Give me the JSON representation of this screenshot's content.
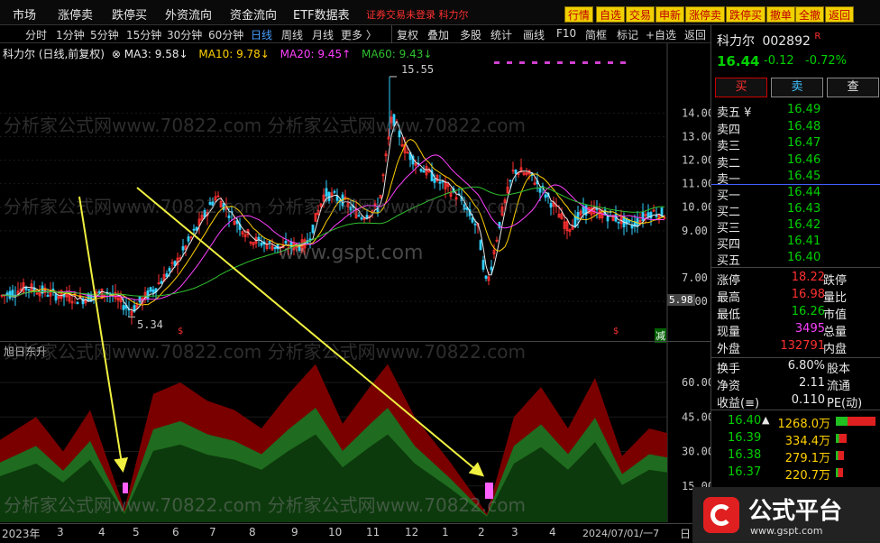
{
  "menu": {
    "items": [
      "市场",
      "涨停卖",
      "跌停买",
      "外资流向",
      "资金流向",
      "ETF数据表"
    ],
    "ticker_text": "证券交易未登录   科力尔",
    "buttons": [
      "行情",
      "自选",
      "交易",
      "申新",
      "涨停卖",
      "跌停买",
      "撤单",
      "全撤",
      "返回"
    ]
  },
  "toolbar": {
    "periods": [
      "分时",
      "1分钟",
      "5分钟",
      "15分钟",
      "30分钟",
      "60分钟",
      "日线",
      "周线",
      "月线",
      "更多 〉"
    ],
    "active_period": "日线",
    "tools": [
      "复权",
      "叠加",
      "多股",
      "统计",
      "画线",
      "F10",
      "简框",
      "标记",
      "+自选",
      "返回"
    ]
  },
  "chart_header": {
    "title": "科力尔 (日线,前复权)",
    "ma3": "MA3: 9.58↓",
    "ma10": "MA10: 9.78↓",
    "ma20": "MA20: 9.45↑",
    "ma60": "MA60: 9.43↓"
  },
  "indicator_title": "旭日东升",
  "annotations": {
    "high": "15.55",
    "low": "5.34",
    "last_price_tag": "5.98",
    "jian": "减"
  },
  "main_axis": [
    "14.00",
    "13.00",
    "12.00",
    "11.00",
    "10.00",
    "9.00",
    "7.00",
    "6.00"
  ],
  "ind_axis": [
    "60.00",
    "45.00",
    "30.00",
    "15.00"
  ],
  "time_axis": [
    "2023年",
    "3",
    "4",
    "5",
    "6",
    "7",
    "8",
    "9",
    "10",
    "11",
    "12",
    "1",
    "2",
    "3",
    "4",
    "2024/07/01/一7",
    "日"
  ],
  "watermarks": [
    "分析家公式网www.70822.com",
    "www.gspt.com"
  ],
  "stock": {
    "name": "科力尔",
    "code": "002892",
    "tag": "R",
    "price": "16.44",
    "change": "-0.12",
    "change_pct": "-0.72%"
  },
  "trade_buttons": [
    "买",
    "卖",
    "查"
  ],
  "order_book": {
    "sell": [
      {
        "label": "卖五 ¥",
        "price": "16.49"
      },
      {
        "label": "卖四",
        "price": "16.48"
      },
      {
        "label": "卖三",
        "price": "16.47"
      },
      {
        "label": "卖二",
        "price": "16.46"
      },
      {
        "label": "卖一",
        "price": "16.45"
      }
    ],
    "buy": [
      {
        "label": "买一",
        "price": "16.44"
      },
      {
        "label": "买二",
        "price": "16.43"
      },
      {
        "label": "买三",
        "price": "16.42"
      },
      {
        "label": "买四",
        "price": "16.41"
      },
      {
        "label": "买五",
        "price": "16.40"
      }
    ]
  },
  "stats": [
    {
      "l": "涨停",
      "v": "18.22",
      "r": "跌停"
    },
    {
      "l": "最高",
      "v": "16.98",
      "r": "量比"
    },
    {
      "l": "最低",
      "v": "16.26",
      "r": "市值"
    },
    {
      "l": "现量",
      "v": "3495",
      "r": "总量"
    },
    {
      "l": "外盘",
      "v": "132791",
      "r": "内盘"
    }
  ],
  "fund": [
    {
      "l": "换手",
      "v": "6.80%",
      "r": "股本"
    },
    {
      "l": "净资",
      "v": "2.11",
      "r": "流通"
    },
    {
      "l": "收益(≡)",
      "v": "0.110",
      "r": "PE(动)"
    }
  ],
  "ticks": [
    {
      "p": "16.40",
      "arrow": "▲",
      "v": "1268.0万"
    },
    {
      "p": "16.39",
      "arrow": "",
      "v": "334.4万"
    },
    {
      "p": "16.38",
      "arrow": "",
      "v": "279.1万"
    },
    {
      "p": "16.37",
      "arrow": "",
      "v": "220.7万"
    }
  ],
  "logo": {
    "text": "公式平台",
    "url": "www.gspt.com"
  }
}
